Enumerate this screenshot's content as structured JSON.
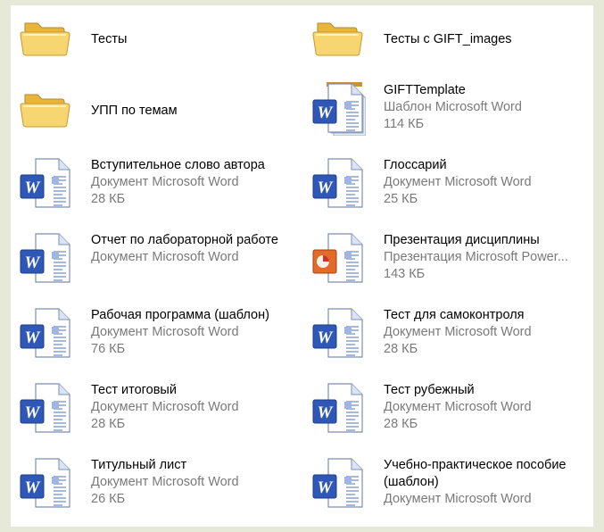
{
  "colors": {
    "background": "#e6e8d8",
    "panel": "#ffffff",
    "secondary_text": "#7a7a7a",
    "word_blue": "#2f57b6",
    "folder_yellow": "#f2c95a"
  },
  "items": [
    {
      "name": "Тесты",
      "type": "",
      "size": "",
      "icon": "folder-icon"
    },
    {
      "name": "Тесты с GIFT_images",
      "type": "",
      "size": "",
      "icon": "folder-icon"
    },
    {
      "name": "УПП по темам",
      "type": "",
      "size": "",
      "icon": "folder-icon"
    },
    {
      "name": "GIFTTemplate",
      "type": "Шаблон Microsoft Word",
      "size": "114 КБ",
      "icon": "word-template-icon"
    },
    {
      "name": "Вступительное слово автора",
      "type": "Документ Microsoft Word",
      "size": "28 КБ",
      "icon": "word-document-icon"
    },
    {
      "name": "Глоссарий",
      "type": "Документ Microsoft Word",
      "size": "25 КБ",
      "icon": "word-document-icon"
    },
    {
      "name": "Отчет по лабораторной работе",
      "type": "Документ Microsoft Word",
      "size": "",
      "icon": "word-document-icon"
    },
    {
      "name": "Презентация дисциплины",
      "type": "Презентация Microsoft Power...",
      "size": "143 КБ",
      "icon": "powerpoint-document-icon"
    },
    {
      "name": "Рабочая программа (шаблон)",
      "type": "Документ Microsoft Word",
      "size": "76 КБ",
      "icon": "word-document-icon"
    },
    {
      "name": "Тест для самоконтроля",
      "type": "Документ Microsoft Word",
      "size": "28 КБ",
      "icon": "word-document-icon"
    },
    {
      "name": "Тест итоговый",
      "type": "Документ Microsoft Word",
      "size": "28 КБ",
      "icon": "word-document-icon"
    },
    {
      "name": "Тест рубежный",
      "type": "Документ Microsoft Word",
      "size": "28 КБ",
      "icon": "word-document-icon"
    },
    {
      "name": "Титульный лист",
      "type": "Документ Microsoft Word",
      "size": "26 КБ",
      "icon": "word-document-icon"
    },
    {
      "name": "Учебно-практическое пособие (шаблон)",
      "type": "Документ Microsoft Word",
      "size": "",
      "icon": "word-document-icon"
    }
  ]
}
